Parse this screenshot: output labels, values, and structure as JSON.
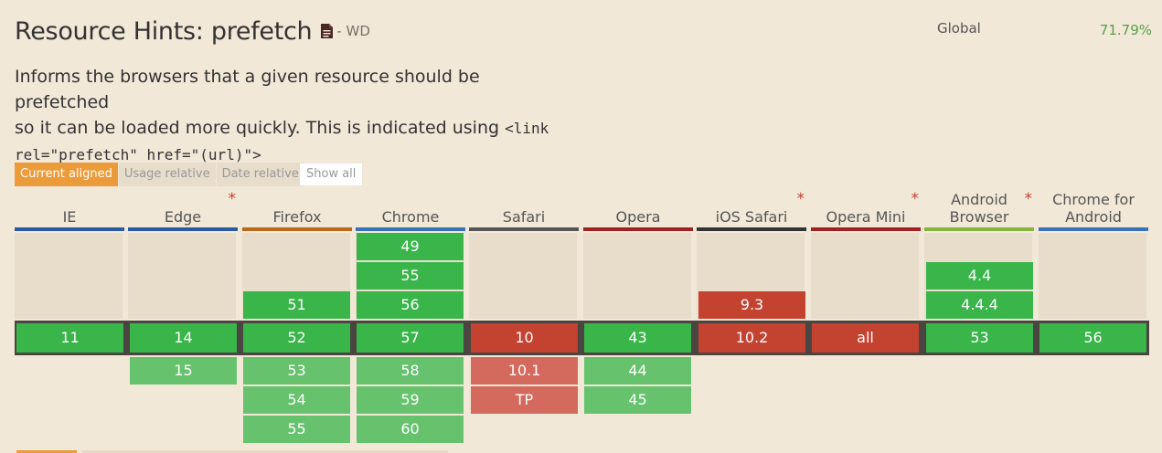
{
  "header": {
    "title": "Resource Hints: prefetch",
    "status": "- WD",
    "global_label": "Global",
    "global_value": "71.79%"
  },
  "description": {
    "line1": "Informs the browsers that a given resource should be prefetched",
    "line2": "so it can be loaded more quickly. This is indicated using ",
    "code1": "<link",
    "code2": "rel=\"prefetch\" href=\"(url)\">"
  },
  "tabs": {
    "current_aligned": "Current aligned",
    "usage_relative": "Usage relative",
    "date_relative": "Date relative",
    "show_all": "Show all"
  },
  "browsers": [
    {
      "name": "IE",
      "color": "#2c5a9e",
      "star": ""
    },
    {
      "name": "Edge",
      "color": "#2c5a9e",
      "star": "*"
    },
    {
      "name": "Firefox",
      "color": "#b86a1a",
      "star": ""
    },
    {
      "name": "Chrome",
      "color": "#3a72b8",
      "star": ""
    },
    {
      "name": "Safari",
      "color": "#555555",
      "star": ""
    },
    {
      "name": "Opera",
      "color": "#9e2222",
      "star": ""
    },
    {
      "name": "iOS Safari",
      "color": "#333333",
      "star": "*"
    },
    {
      "name": "Opera Mini",
      "color": "#9e2222",
      "star": "*"
    },
    {
      "name": "Android Browser",
      "line1": "Android",
      "line2": "Browser",
      "color": "#86b43e",
      "star": "*"
    },
    {
      "name": "Chrome for Android",
      "line1": "Chrome for",
      "line2": "Android",
      "color": "#3a72b8",
      "star": ""
    }
  ],
  "versions": {
    "chrome_past": [
      "49",
      "55",
      "56"
    ],
    "firefox_past": [
      "51"
    ],
    "ios_past": [
      "9.3"
    ],
    "android_past": [
      "4.4",
      "4.4.4"
    ],
    "current": [
      "11",
      "14",
      "52",
      "57",
      "10",
      "43",
      "10.2",
      "all",
      "53",
      "56"
    ],
    "edge_future": [
      "15"
    ],
    "firefox_future": [
      "53",
      "54",
      "55"
    ],
    "chrome_future": [
      "58",
      "59",
      "60"
    ],
    "safari_future": [
      "10.1",
      "TP"
    ],
    "opera_future": [
      "44",
      "45"
    ]
  },
  "colors": {
    "supported": "#39b54a",
    "not_supported": "#c44230",
    "supported_future": "#66c26d",
    "not_supported_future": "#d4695d",
    "accent": "#ec9b3a",
    "global_value": "#5aa04a"
  }
}
